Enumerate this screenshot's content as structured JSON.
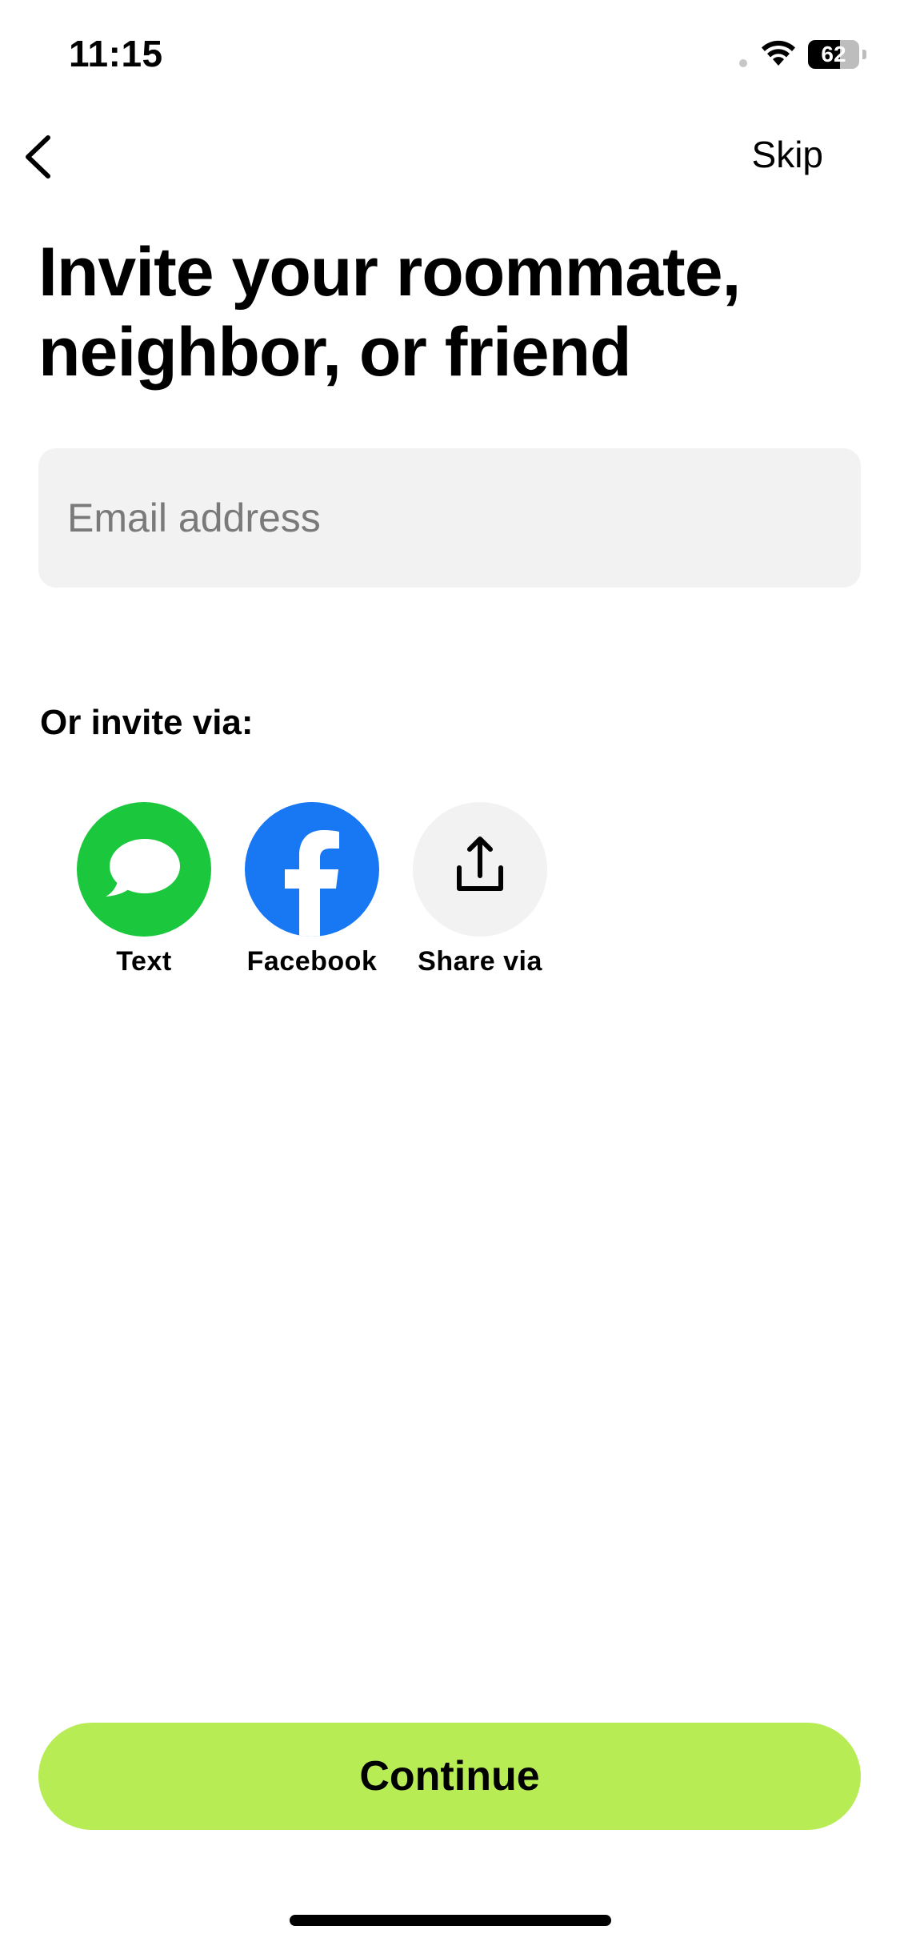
{
  "status_bar": {
    "time": "11:15",
    "battery_level": "62",
    "battery_fraction": 0.62
  },
  "nav": {
    "back_icon": "chevron-left-icon",
    "skip_label": "Skip"
  },
  "title": "Invite your roommate, neighbor, or friend",
  "email": {
    "placeholder": "Email address",
    "value": ""
  },
  "invite_via": {
    "label": "Or invite via:",
    "options": [
      {
        "label": "Text",
        "icon": "message-bubble-icon",
        "color": "#1bc73c"
      },
      {
        "label": "Facebook",
        "icon": "facebook-icon",
        "color": "#1877f2"
      },
      {
        "label": "Share via",
        "icon": "share-icon",
        "color": "#f2f2f2"
      }
    ]
  },
  "continue_label": "Continue",
  "colors": {
    "accent": "#b8ec55",
    "field_background": "#f2f2f2"
  }
}
